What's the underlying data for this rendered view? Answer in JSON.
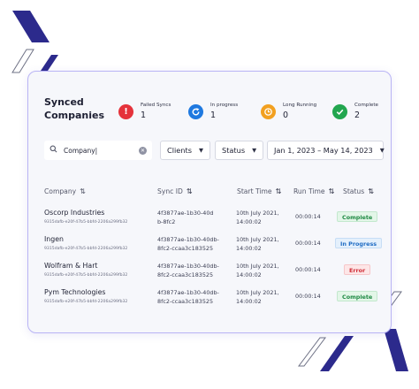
{
  "colors": {
    "failed": "#e5323b",
    "in_progress": "#1f79e0",
    "long_running": "#f2a020",
    "complete": "#22a64f",
    "accent_deco": "#2c2a8c",
    "card_border": "#b9b4f5"
  },
  "header": {
    "title": "Synced Companies"
  },
  "stats": [
    {
      "label": "Failed Syncs",
      "value": "1",
      "icon": "exclamation-icon"
    },
    {
      "label": "In progress",
      "value": "1",
      "icon": "refresh-icon"
    },
    {
      "label": "Long Running",
      "value": "0",
      "icon": "clock-icon"
    },
    {
      "label": "Complete",
      "value": "2",
      "icon": "check-icon"
    }
  ],
  "search": {
    "value": "Company|",
    "placeholder": "Search"
  },
  "filters": {
    "clients_label": "Clients",
    "status_label": "Status",
    "date_range": "Jan 1, 2023 – May 14, 2023"
  },
  "table": {
    "columns": [
      "Company",
      "Sync ID",
      "Start Time",
      "Run Time",
      "Status"
    ],
    "rows": [
      {
        "company": "Oscorp Industries",
        "company_id": "9315dafb-e20f-47b5-bbfd-2206a299fb32",
        "sync_id_line1": "4f3877ae-1b30-40d",
        "sync_id_line2": "b-8fc2",
        "start_line1": "10th July 2021,",
        "start_line2": "14:00:02",
        "run_time": "00:00:14",
        "status": "Complete",
        "status_kind": "complete"
      },
      {
        "company": "Ingen",
        "company_id": "9315dafb-e20f-47b5-bbfd-2206a299fb32",
        "sync_id_line1": "4f3877ae-1b30-40db-",
        "sync_id_line2": "8fc2-ccaa3c183525",
        "start_line1": "10th July 2021,",
        "start_line2": "14:00:02",
        "run_time": "00:00:14",
        "status": "In Progress",
        "status_kind": "progress"
      },
      {
        "company": "Wolfram & Hart",
        "company_id": "9315dafb-e20f-47b5-bbfd-2206a299fb32",
        "sync_id_line1": "4f3877ae-1b30-40db-",
        "sync_id_line2": "8fc2-ccaa3c183525",
        "start_line1": "10th July 2021,",
        "start_line2": "14:00:02",
        "run_time": "00:00:14",
        "status": "Error",
        "status_kind": "error"
      },
      {
        "company": "Pym Technologies",
        "company_id": "9315dafb-e20f-47b5-bbfd-2206a299fb32",
        "sync_id_line1": "4f3877ae-1b30-40db-",
        "sync_id_line2": "8fc2-ccaa3c183525",
        "start_line1": "10th July 2021,",
        "start_line2": "14:00:02",
        "run_time": "00:00:14",
        "status": "Complete",
        "status_kind": "complete"
      }
    ]
  }
}
